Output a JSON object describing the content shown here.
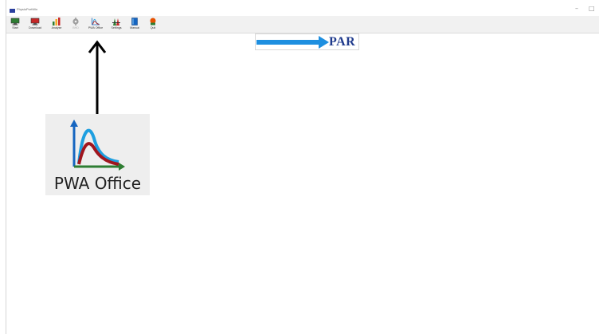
{
  "window": {
    "title": "PhysioPortWin",
    "controls": {
      "minimize": "–",
      "maximize": "□"
    }
  },
  "toolbar": {
    "items": [
      {
        "label": "Start",
        "icon": "monitor-start-icon",
        "enabled": true
      },
      {
        "label": "Download",
        "icon": "monitor-download-icon",
        "enabled": true
      },
      {
        "label": "Analyse",
        "icon": "bar-chart-icon",
        "enabled": true
      },
      {
        "label": "BHD",
        "icon": "gear-icon",
        "enabled": false
      },
      {
        "label": "PWA Office",
        "icon": "pwa-office-icon",
        "enabled": true
      },
      {
        "label": "Settings",
        "icon": "settings-icon",
        "enabled": true
      },
      {
        "label": "Manual",
        "icon": "manual-book-icon",
        "enabled": true
      },
      {
        "label": "Quit",
        "icon": "quit-icon",
        "enabled": true
      }
    ]
  },
  "branding": {
    "logo_text": "PAR",
    "logo_color": "#1f3a8c",
    "arrow_color": "#1e8fe0"
  },
  "callout": {
    "label": "PWA Office",
    "icon": "pwa-office-icon"
  }
}
